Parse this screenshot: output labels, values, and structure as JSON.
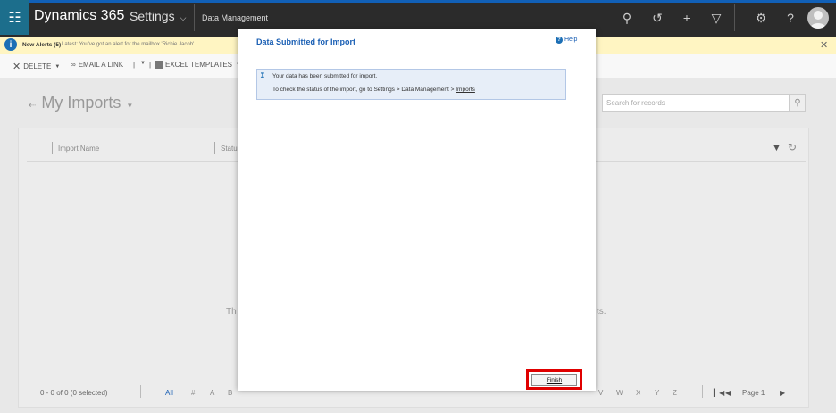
{
  "topbar": {
    "brand": "Dynamics 365",
    "settings": "Settings",
    "area": "Data Management",
    "icons": [
      "waffle-icon",
      "search-icon",
      "recent-icon",
      "plus-icon",
      "filter-icon",
      "gear-icon",
      "question-icon",
      "avatar-icon"
    ]
  },
  "alerts": {
    "title": "New Alerts (5)",
    "text": "Latest: You've got an alert for the mailbox 'Richie Jacob'..."
  },
  "commands": {
    "delete": "DELETE",
    "email_link": "EMAIL A LINK",
    "excel_templates": "EXCEL TEMPLATES"
  },
  "view": {
    "title": "My Imports",
    "search_placeholder": "Search for records",
    "col_import_name": "Import Name",
    "col_status": "Statu",
    "empty_left": "Th",
    "empty_right": "ts.",
    "record_count": "0 - 0 of 0 (0 selected)",
    "letters_left": [
      "All",
      "#",
      "A",
      "B"
    ],
    "letters_right": [
      "V",
      "W",
      "X",
      "Y",
      "Z"
    ],
    "page_label": "Page 1"
  },
  "modal": {
    "title": "Data Submitted for Import",
    "help": "Help",
    "info_line1": "Your data has been submitted for import.",
    "info_line2_prefix": "To check the status of the import, go to Settings > Data Management > ",
    "info_line2_link": "Imports",
    "finish_button": "Finish"
  },
  "colors": {
    "accent": "#1a5fb4",
    "highlight": "#e00000",
    "topbar": "#2b2b2b",
    "alertbar": "#fff5c2"
  }
}
